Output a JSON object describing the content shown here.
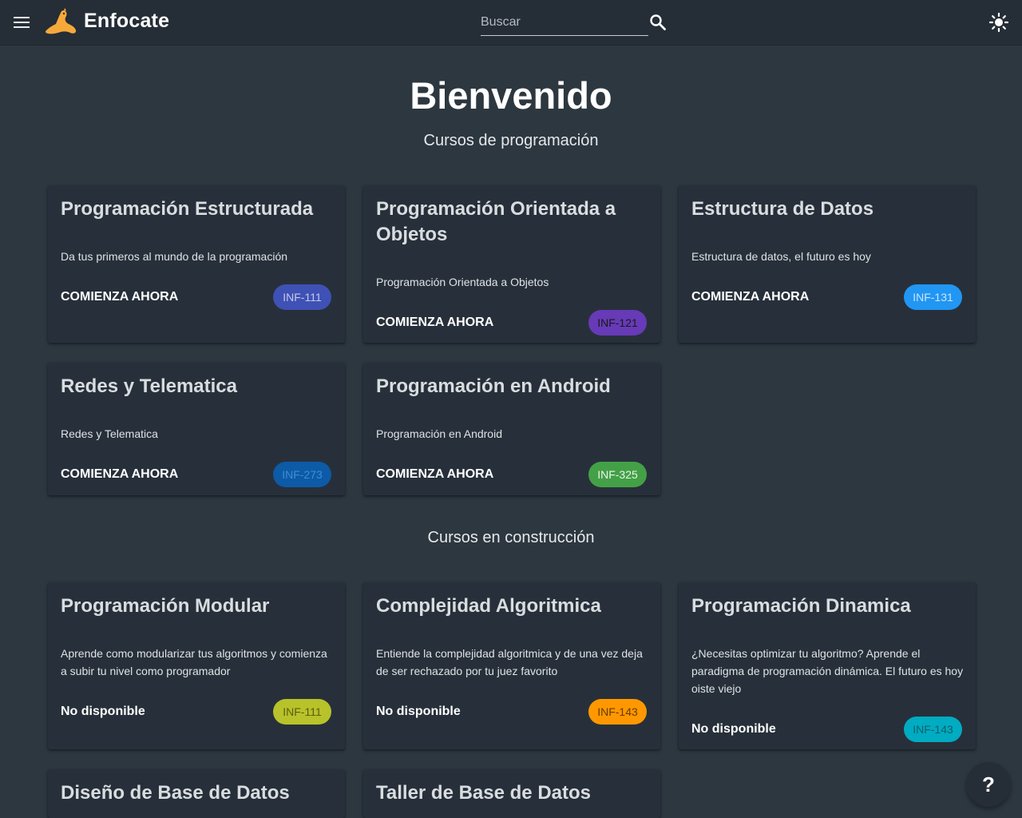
{
  "app": {
    "title": "Enfocate"
  },
  "search": {
    "placeholder": "Buscar"
  },
  "icons": {
    "menu": "menu-icon",
    "logo": "seal-logo",
    "search": "search-icon",
    "theme": "sun-icon",
    "help": "help-icon"
  },
  "hero": {
    "title": "Bienvenido"
  },
  "sections": {
    "programming": "Cursos de programación",
    "construction": "Cursos en construcción"
  },
  "courses": [
    {
      "title": "Programación Estructurada",
      "description": "Da tus primeros al mundo de la programación",
      "action": "COMIENZA AHORA",
      "code": "INF-111",
      "chip_color": "#3f51b5",
      "chip_text_color": "#c5cae9"
    },
    {
      "title": "Programación Orientada a Objetos",
      "description": "Programación Orientada a Objetos",
      "action": "COMIENZA AHORA",
      "code": "INF-121",
      "chip_color": "#673ab7",
      "chip_text_color": "#1a1a1a"
    },
    {
      "title": "Estructura de Datos",
      "description": "Estructura de datos, el futuro es hoy",
      "action": "COMIENZA AHORA",
      "code": "INF-131",
      "chip_color": "#2196f3",
      "chip_text_color": "#c8e6ff"
    },
    {
      "title": "Redes y Telematica",
      "description": "Redes y Telematica",
      "action": "COMIENZA AHORA",
      "code": "INF-273",
      "chip_color": "#0d5aa7",
      "chip_text_color": "#3b8fd6"
    },
    {
      "title": "Programación en Android",
      "description": "Programación en Android",
      "action": "COMIENZA AHORA",
      "code": "INF-325",
      "chip_color": "#43a047",
      "chip_text_color": "#e8f5e9"
    }
  ],
  "upcoming": [
    {
      "title": "Programación Modular",
      "description": "Aprende como modularizar tus algoritmos y comienza a subir tu nivel como programador",
      "action": "No disponible",
      "code": "INF-111",
      "chip_color": "#b8c22a",
      "chip_text_color": "#5a5f10"
    },
    {
      "title": "Complejidad Algoritmica",
      "description": "Entiende la complejidad algoritmica y de una vez deja de ser rechazado por tu juez favorito",
      "action": "No disponible",
      "code": "INF-143",
      "chip_color": "#ff9800",
      "chip_text_color": "#6b3a00"
    },
    {
      "title": "Programación Dinamica",
      "description": "¿Necesitas optimizar tu algoritmo? Aprende el paradigma de programación dinámica. El futuro es hoy oiste viejo",
      "action": "No disponible",
      "code": "INF-143",
      "chip_color": "#00acc1",
      "chip_text_color": "#0d5f6b"
    },
    {
      "title": "Diseño de Base de Datos"
    },
    {
      "title": "Taller de Base de Datos"
    }
  ],
  "help": {
    "label": "?"
  }
}
